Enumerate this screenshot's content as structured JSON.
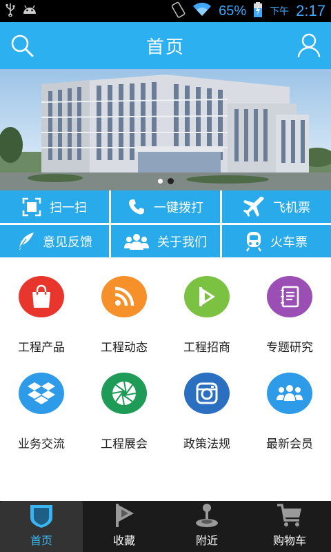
{
  "status_bar": {
    "battery_percent": "65%",
    "ampm": "下午",
    "time": "2:17"
  },
  "header": {
    "title": "首页"
  },
  "banner": {
    "slide_count": 2,
    "active_slide": 1
  },
  "quick_actions": [
    {
      "label": "扫一扫",
      "icon": "scan-icon"
    },
    {
      "label": "一键拨打",
      "icon": "phone-icon"
    },
    {
      "label": "飞机票",
      "icon": "airplane-icon"
    },
    {
      "label": "意见反馈",
      "icon": "feather-icon"
    },
    {
      "label": "关于我们",
      "icon": "people-icon"
    },
    {
      "label": "火车票",
      "icon": "train-icon"
    }
  ],
  "grid": [
    {
      "label": "工程产品",
      "icon": "shopping-bag-icon",
      "color": "#e8362c"
    },
    {
      "label": "工程动态",
      "icon": "rss-icon",
      "color": "#f5902a"
    },
    {
      "label": "工程招商",
      "icon": "flag-play-icon",
      "color": "#7cc242"
    },
    {
      "label": "专题研究",
      "icon": "notebook-icon",
      "color": "#9b4fb5"
    },
    {
      "label": "业务交流",
      "icon": "dropbox-icon",
      "color": "#2d9be8"
    },
    {
      "label": "工程展会",
      "icon": "aperture-icon",
      "color": "#1e9b57"
    },
    {
      "label": "政策法规",
      "icon": "camera-icon",
      "color": "#2a6fc0"
    },
    {
      "label": "最新会员",
      "icon": "members-icon",
      "color": "#2d9be8"
    }
  ],
  "bottom_nav": [
    {
      "label": "首页",
      "icon": "home-shield-icon",
      "active": true
    },
    {
      "label": "收藏",
      "icon": "flag-icon",
      "active": false
    },
    {
      "label": "附近",
      "icon": "joystick-icon",
      "active": false
    },
    {
      "label": "购物车",
      "icon": "cart-icon",
      "active": false
    }
  ]
}
